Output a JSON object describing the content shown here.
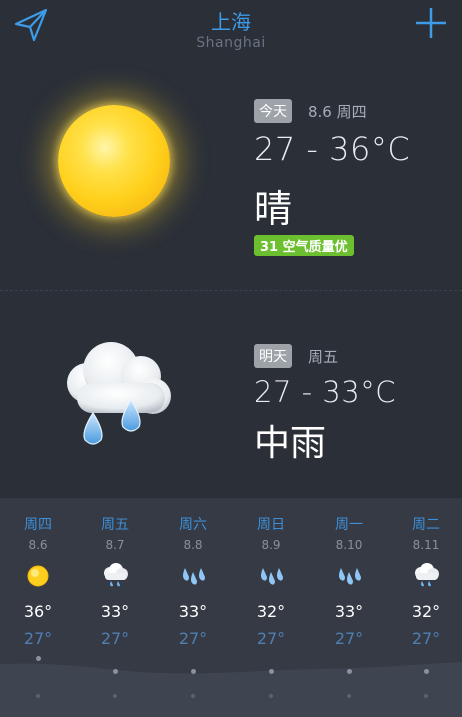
{
  "header": {
    "city": "上海",
    "city_en": "Shanghai"
  },
  "today": {
    "label": "今天",
    "date": "8.6 周四",
    "temp": "27 - 36°C",
    "condition": "晴",
    "aqi": "31 空气质量优",
    "icon": "sun-icon"
  },
  "tomorrow": {
    "label": "明天",
    "date": "周五",
    "temp": "27 - 33°C",
    "condition": "中雨",
    "icon": "cloud-rain-icon"
  },
  "forecast": [
    {
      "weekday": "周四",
      "date": "8.6",
      "high": "36°",
      "low": "27°",
      "icon": "sun-icon"
    },
    {
      "weekday": "周五",
      "date": "8.7",
      "high": "33°",
      "low": "27°",
      "icon": "cloud-rain-icon"
    },
    {
      "weekday": "周六",
      "date": "8.8",
      "high": "33°",
      "low": "27°",
      "icon": "rain-drops-icon"
    },
    {
      "weekday": "周日",
      "date": "8.9",
      "high": "32°",
      "low": "27°",
      "icon": "rain-drops-icon"
    },
    {
      "weekday": "周一",
      "date": "8.10",
      "high": "33°",
      "low": "27°",
      "icon": "rain-drops-icon"
    },
    {
      "weekday": "周二",
      "date": "8.11",
      "high": "32°",
      "low": "27°",
      "icon": "cloud-rain-icon"
    }
  ],
  "colors": {
    "background": "#2a2f38",
    "accent_blue": "#3d9be8",
    "aqi_green": "#6cbf2f"
  }
}
